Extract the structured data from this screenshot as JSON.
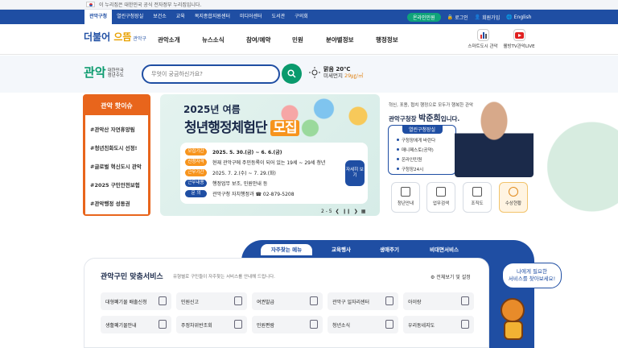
{
  "gov_notice": "이 누리집은 대한민국 공식 전자정부 누리집입니다.",
  "top_nav": {
    "sites": [
      "관악구청",
      "열린구청장실",
      "보건소",
      "교육",
      "복지종합지원센터",
      "미디어센터",
      "도서관",
      "구의회"
    ],
    "active_index": 0,
    "ai_pill": "온라인민원",
    "login": "로그인",
    "join": "회원가입",
    "lang": "English"
  },
  "header": {
    "logo_main": "더불어 ",
    "logo_o": "으뜸",
    "logo_sub": " 관악구",
    "menu": [
      "관악소개",
      "뉴스소식",
      "참여/예약",
      "민원",
      "분야별정보",
      "행정정보"
    ],
    "icons": [
      {
        "label": "스마트도시 관악",
        "icon": "chart-icon"
      },
      {
        "label": "웰빙TV관악LIVE",
        "icon": "youtube-icon"
      }
    ]
  },
  "search": {
    "brand": "관악",
    "brand_sub1": "대한민국",
    "brand_sub2": "청년수도",
    "placeholder": "무엇이 궁금하신가요?",
    "weather_temp": "맑음 20℃",
    "dust_label": "미세먼지 ",
    "dust_value": "29㎍/㎥"
  },
  "hot_issue": {
    "title": "관악 핫이슈",
    "items": [
      "#관악산 자연휴양림",
      "#청년친화도시 선정!",
      "#글로벌 혁신도시 관악",
      "#2025 구민안전보험",
      "#관악행정 성동권"
    ]
  },
  "banner": {
    "title1": "2025년 여름",
    "title2": "청년행정체험단 ",
    "title2_tag": "모집",
    "rows": [
      {
        "label": "모집기간",
        "value": "2025. 5. 30.(금) ~ 6. 6.(금)"
      },
      {
        "label": "신청자격",
        "value": "현재 관악구에 주민등록이 되어 있는 19세 ~ 29세 청년"
      },
      {
        "label": "근무기간",
        "value": "2025. 7. 2.(수) ~ 7. 29.(화)"
      },
      {
        "label": "근무내용",
        "value": "행정업무 보조, 민원안내 등"
      },
      {
        "label": "문   의",
        "value": "관악구청 자치행정과 ☎ 02-879-5208"
      }
    ],
    "more": "자세히 보기",
    "pager": "2 - 5"
  },
  "mayor": {
    "intro": "혁신, 포용, 협치 행정으로 모두가 행복한 관악",
    "name_prefix": "관악구청장 ",
    "name": "박준희",
    "name_suffix": "입니다.",
    "office": "열린구청장실",
    "links": [
      "구청장에게 바란다",
      "매니페스토(공약)",
      "온라인민원",
      "구청장24시"
    ],
    "quick": [
      "청년안내",
      "업무검색",
      "조직도",
      "수상현황"
    ]
  },
  "service_tabs": [
    "자주찾는 메뉴",
    "교육행사",
    "생애주기",
    "비대면서비스"
  ],
  "service": {
    "title": "관악구민 맞춤서비스",
    "sub": "유형별로 구민들이 자주찾는 서비스를 안내해 드립니다.",
    "config": "전체보기 및 설정",
    "row1": [
      "대형폐기물 배출신청",
      "민원신고",
      "여권발급",
      "관악구 일자리센터",
      "아이랑"
    ],
    "row2": [
      "생활폐기물안내",
      "주정차위반조회",
      "민원편람",
      "청년소식",
      "우리동네지도"
    ]
  },
  "bubble": {
    "line1": "나에게 필요한",
    "line2": "서비스를 찾아보세요!"
  }
}
